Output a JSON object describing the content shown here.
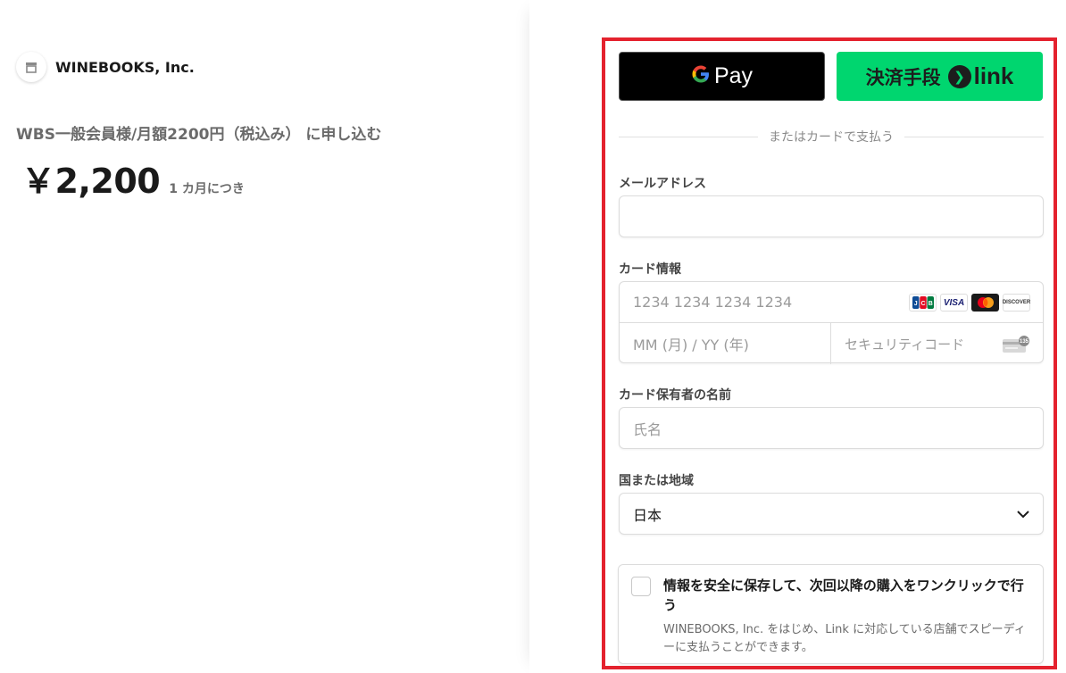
{
  "merchant": {
    "name": "WINEBOOKS, Inc."
  },
  "product": {
    "name": "WBS一般会員様/月額2200円（税込み） に申し込む",
    "price": "￥2,200",
    "period": "1 カ月につき"
  },
  "wallets": {
    "gpay_g": "G",
    "gpay_label": "Pay",
    "link_label": "決済手段",
    "link_arrow": "❯",
    "link_word": "link"
  },
  "divider": {
    "text": "またはカードで支払う"
  },
  "email": {
    "label": "メールアドレス",
    "value": ""
  },
  "card": {
    "label": "カード情報",
    "number_placeholder": "1234 1234 1234 1234",
    "expiry_placeholder": "MM (月) / YY (年)",
    "cvc_placeholder": "セキュリティコード",
    "brands": {
      "jcb": "JCB",
      "visa": "VISA",
      "mastercard": "",
      "discover": "DISCOVER"
    },
    "cvc_icon_text": "135"
  },
  "cardholder": {
    "label": "カード保有者の名前",
    "placeholder": "氏名"
  },
  "country": {
    "label": "国または地域",
    "value": "日本"
  },
  "save": {
    "title": "情報を安全に保存して、次回以降の購入をワンクリックで行う",
    "description": "WINEBOOKS, Inc. をはじめ、Link に対応している店舗でスピーディーに支払うことができます。"
  },
  "colors": {
    "highlight": "#e4222e",
    "link_green": "#00d66f",
    "gpay_black": "#000000"
  }
}
